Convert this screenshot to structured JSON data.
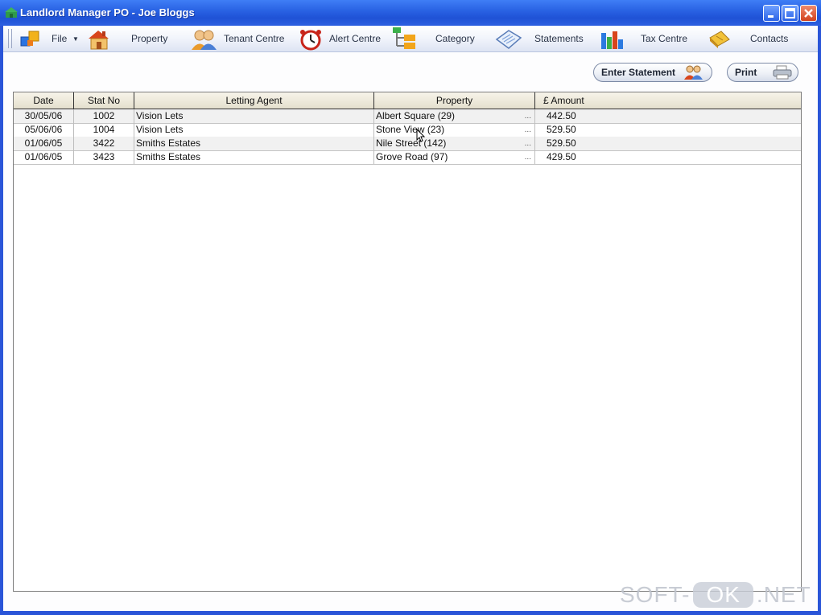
{
  "window": {
    "title": "Landlord Manager PO - Joe Bloggs"
  },
  "toolbar": {
    "items": [
      {
        "label": "File",
        "icon": "file-blocks-icon"
      },
      {
        "label": "Property",
        "icon": "house-icon"
      },
      {
        "label": "Tenant Centre",
        "icon": "people-icon"
      },
      {
        "label": "Alert Centre",
        "icon": "alarm-clock-icon"
      },
      {
        "label": "Category",
        "icon": "category-tree-icon"
      },
      {
        "label": "Statements",
        "icon": "document-icon"
      },
      {
        "label": "Tax Centre",
        "icon": "bar-chart-icon"
      },
      {
        "label": "Contacts",
        "icon": "contacts-book-icon"
      }
    ]
  },
  "actions": {
    "enter_statement": "Enter Statement",
    "print": "Print"
  },
  "table": {
    "headers": [
      "Date",
      "Stat No",
      "Letting Agent",
      "Property",
      "£ Amount"
    ],
    "rows": [
      {
        "date": "30/05/06",
        "stat_no": "1002",
        "agent": "Vision Lets",
        "property": "Albert Square (29)",
        "amount": "442.50"
      },
      {
        "date": "05/06/06",
        "stat_no": "1004",
        "agent": "Vision Lets",
        "property": "Stone View (23)",
        "amount": "529.50"
      },
      {
        "date": "01/06/05",
        "stat_no": "3422",
        "agent": "Smiths Estates",
        "property": "Nile Street (142)",
        "amount": "529.50"
      },
      {
        "date": "01/06/05",
        "stat_no": "3423",
        "agent": "Smiths Estates",
        "property": "Grove Road (97)",
        "amount": "429.50"
      }
    ],
    "ellipsis": "..."
  },
  "watermark": {
    "left": "SOFT-",
    "mid": "OK",
    "right": ".NET"
  },
  "colors": {
    "titlebar": "#2a63e4",
    "header_bg": "#e4dfcd",
    "alt_row": "#f1f1f1"
  }
}
